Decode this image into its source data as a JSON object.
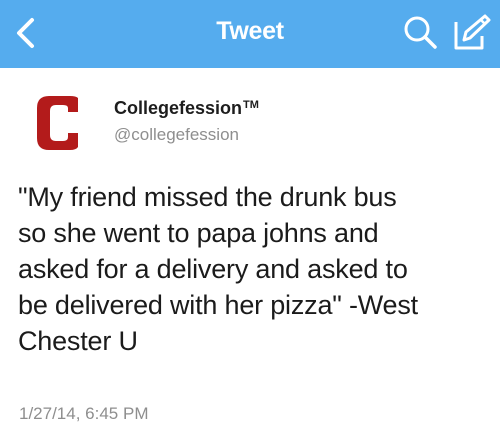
{
  "navbar": {
    "title": "Tweet",
    "back_icon": "chevron-left-icon",
    "search_icon": "search-icon",
    "compose_icon": "compose-icon",
    "bg_color": "#55acee"
  },
  "tweet": {
    "avatar_letter": "C",
    "avatar_color": "#b31b1b",
    "display_name": "Collegefession",
    "trademark": "TM",
    "handle": "@collegefession",
    "text_lines": [
      "\"My friend missed the drunk bus",
      "so she went to papa johns and",
      "asked for a delivery and asked to",
      "be delivered with her pizza\" -West",
      "Chester U"
    ],
    "timestamp": "1/27/14, 6:45 PM"
  }
}
